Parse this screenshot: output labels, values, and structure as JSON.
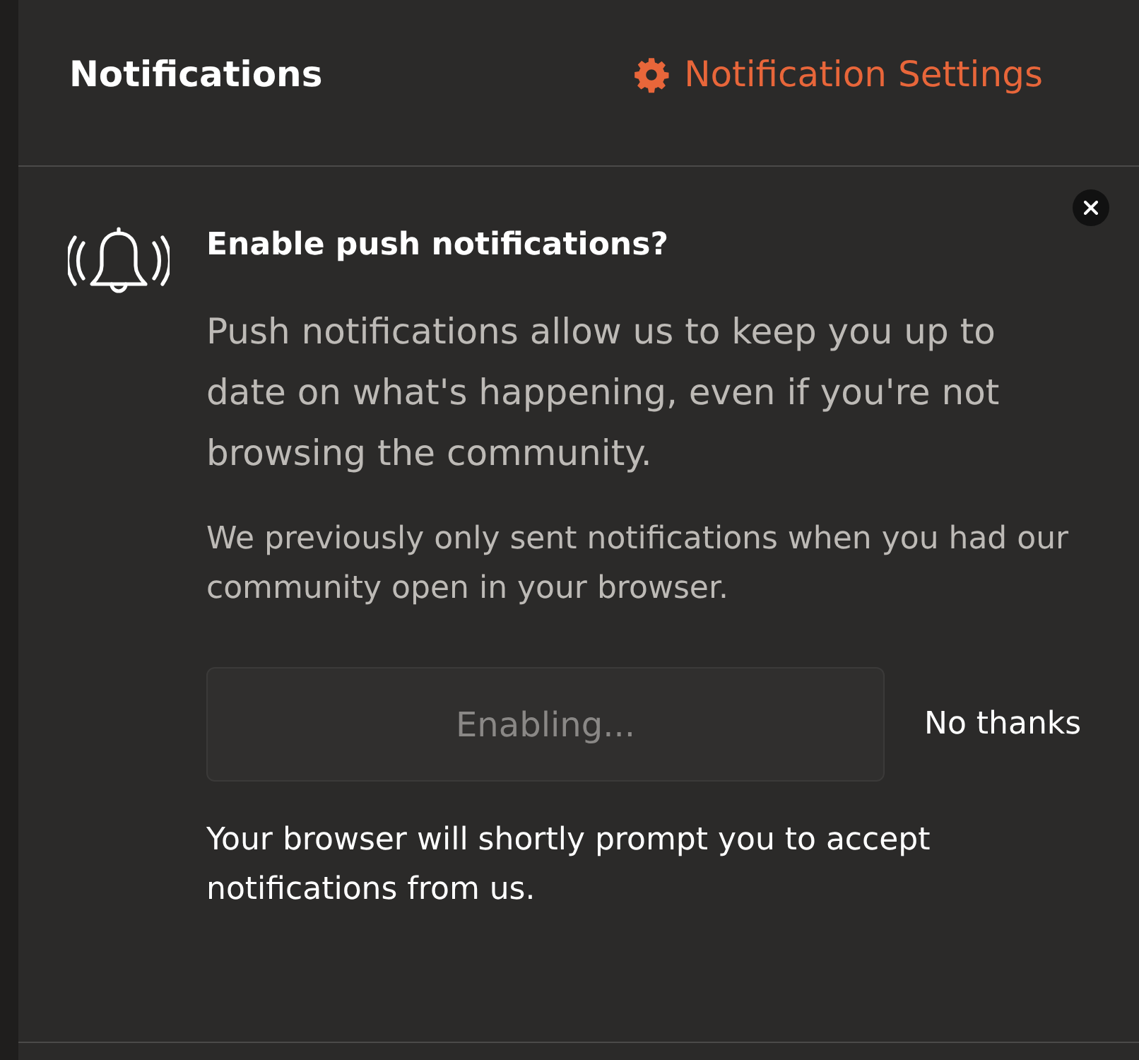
{
  "header": {
    "title": "Notifications",
    "settings_link": {
      "label": "Notification Settings"
    }
  },
  "prompt": {
    "title": "Enable push notifications?",
    "body": "Push notifications allow us to keep you up to date on what's happening, even if you're not browsing the community.",
    "note": "We previously only sent notifications when you had our community open in your browser.",
    "enable_button": {
      "label": "Enabling...",
      "disabled": true
    },
    "dismiss_button": {
      "label": "No thanks"
    },
    "status_message": "Your browser will shortly prompt you to accept notifications from us."
  }
}
